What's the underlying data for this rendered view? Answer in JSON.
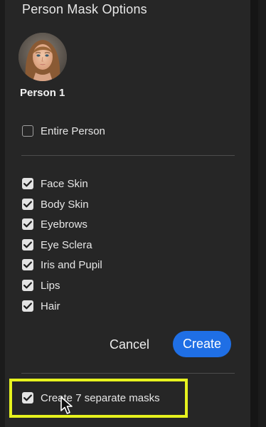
{
  "dialog": {
    "title": "Person Mask Options"
  },
  "person": {
    "name": "Person 1",
    "avatar_icon": "person-portrait-thumbnail"
  },
  "entire_person": {
    "label": "Entire Person",
    "checked": false
  },
  "mask_parts": [
    {
      "label": "Face Skin",
      "checked": true
    },
    {
      "label": "Body Skin",
      "checked": true
    },
    {
      "label": "Eyebrows",
      "checked": true
    },
    {
      "label": "Eye Sclera",
      "checked": true
    },
    {
      "label": "Iris and Pupil",
      "checked": true
    },
    {
      "label": "Lips",
      "checked": true
    },
    {
      "label": "Hair",
      "checked": true
    }
  ],
  "buttons": {
    "cancel_label": "Cancel",
    "create_label": "Create"
  },
  "separate_masks": {
    "label": "Create 7 separate masks",
    "checked": true
  },
  "colors": {
    "panel_background": "#262626",
    "primary_button": "#1f6fe5",
    "highlight": "#e6f21e",
    "checkbox_fill": "#e3e3e3"
  }
}
